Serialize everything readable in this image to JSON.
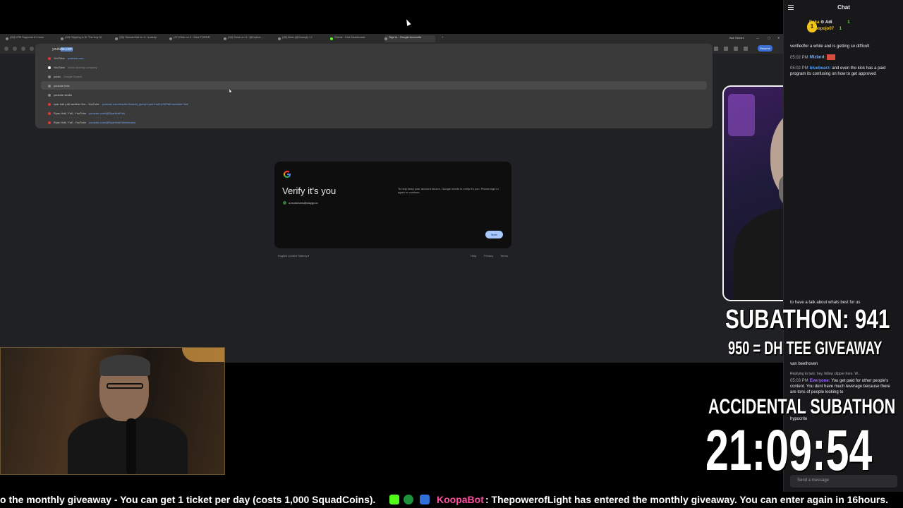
{
  "browser": {
    "tabs": [
      "(28) KFB Supports th 'boss",
      "(28) Clipping is th 'The boy St",
      "(28) ShowerNet on X: 'subsky",
      "(27) Dink on X: 'Mod FORDR",
      "(28) Snick on X: '@Kryline...",
      "(28) Beat (@Sounpl) / X",
      "Streak · Kick Dashboard",
      "Sign in - Google Accounts"
    ],
    "active_tab_index": 7,
    "right_controls": [
      "Ask Gemini"
    ],
    "toolbar_pills": [
      "AI Mode",
      "Resume"
    ],
    "omnibox_typed": "youtu",
    "omnibox_autocomplete": "be.com",
    "suggestions": [
      {
        "title": "YouTube",
        "detail": "youtube.com",
        "type": "url"
      },
      {
        "title": "YouTube",
        "detail": "Video sharing company",
        "type": "entity"
      },
      {
        "title": "youtu",
        "detail": "Google Search",
        "type": "search"
      },
      {
        "title": "youtube kids",
        "detail": "",
        "type": "search"
      },
      {
        "title": "youtube studio",
        "detail": "",
        "type": "search"
      },
      {
        "title": "ryan hall y'all weather live - YouTube",
        "detail": "youtube.com/results?search_query=ryan+hall+y%27all+weather+live",
        "type": "url"
      },
      {
        "title": "Ryan Hall, Y'all - YouTube",
        "detail": "youtube.com/@RyanHallYall",
        "type": "url"
      },
      {
        "title": "Ryan Hall, Y'all - YouTube",
        "detail": "youtube.com/@RyanHallYall/streams",
        "type": "url"
      }
    ],
    "verify_card": {
      "title": "Verify it's you",
      "account": "a.ecatorians@waygo.io",
      "message": "To help keep your account secure, Google needs to verify it's you. Please sign in again to continue.",
      "next_label": "Next"
    },
    "footer": {
      "language": "English (United States)",
      "help": "Help",
      "privacy": "Privacy",
      "terms": "Terms"
    }
  },
  "overlay": {
    "subathon": "SUBATHON: 941",
    "giveaway": "950 = DH TEE GIVEAWAY",
    "accidental": "ACCIDENTAL SUBATHON",
    "timer": "21:09:54"
  },
  "chat": {
    "title": "Chat",
    "leaderboard": [
      {
        "name": "Daka",
        "extra": "Adi",
        "count": "1"
      },
      {
        "name": "popojo07",
        "prefix": "12",
        "count": "1"
      }
    ],
    "messages": [
      {
        "time": "",
        "user": "",
        "text": "verifiedfor a while and is getting so difficult"
      },
      {
        "time": "05:02 PM",
        "user": "Mizlard:",
        "text": ""
      },
      {
        "time": "05:02 PM",
        "user": "bluebearz:",
        "text": "and even tho kick has a paid program its confusing on how to get approved"
      },
      {
        "time": "",
        "user": "",
        "text": "to have a talk about whats best for us"
      },
      {
        "time": "",
        "user": "",
        "text": "van beethoven"
      },
      {
        "time": "",
        "user": "",
        "text": "Replying to twix: hey, fellow clipper here. W..."
      },
      {
        "time": "05:03 PM",
        "user": "Everyone:",
        "text": "You get paid for other people's content. You dont have much leverage because there are tons of people looking to"
      },
      {
        "time": "",
        "user": "",
        "text": "hypocrite"
      }
    ],
    "input_placeholder": "Send a message"
  },
  "ticker": {
    "segment1": "o the monthly giveaway - You can get 1 ticket per day (costs 1,000 SquadCoins).",
    "bot_name": "KoopaBot",
    "segment2": ": ThepowerofLight has entered the monthly giveaway. You can enter again in 16hours."
  }
}
